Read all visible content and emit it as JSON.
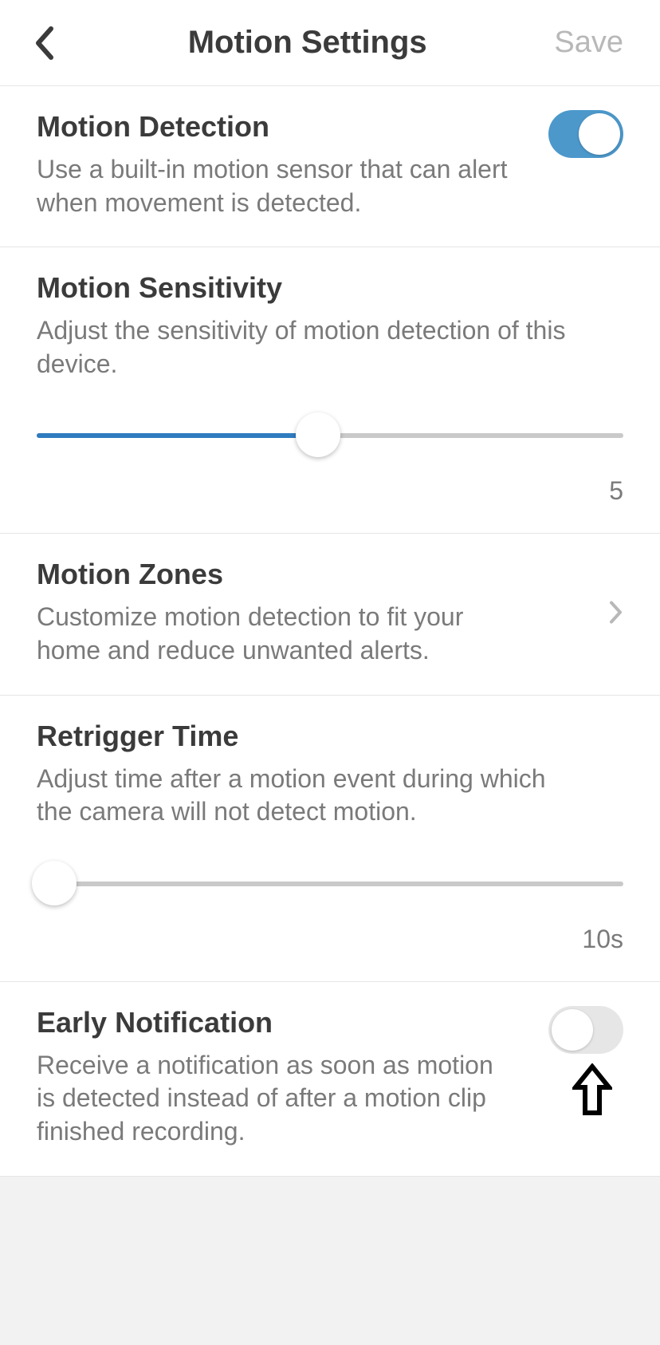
{
  "header": {
    "title": "Motion Settings",
    "save_label": "Save"
  },
  "motion_detection": {
    "title": "Motion Detection",
    "desc": "Use a built-in motion sensor that can alert when movement is detected.",
    "enabled": true
  },
  "motion_sensitivity": {
    "title": "Motion Sensitivity",
    "desc": "Adjust the sensitivity of motion detection of this device.",
    "value_label": "5",
    "slider_percent": 48
  },
  "motion_zones": {
    "title": "Motion Zones",
    "desc": "Customize motion detection to fit your home and reduce unwanted alerts."
  },
  "retrigger_time": {
    "title": "Retrigger Time",
    "desc": "Adjust time after a motion event during which the camera will not detect motion.",
    "value_label": "10s",
    "slider_percent": 0
  },
  "early_notification": {
    "title": "Early Notification",
    "desc": "Receive a notification as soon as motion is detected instead of after a motion clip finished recording.",
    "enabled": false
  }
}
